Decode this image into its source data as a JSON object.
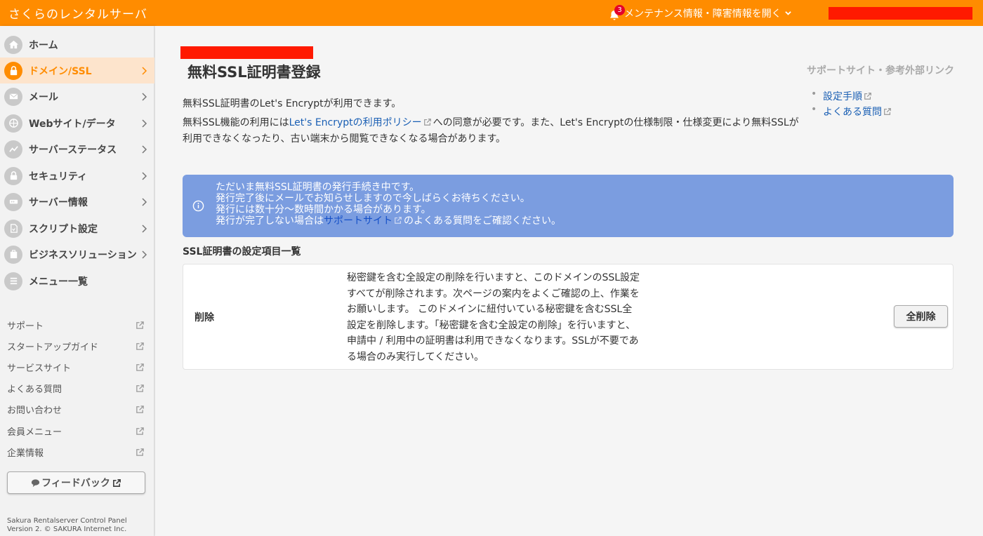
{
  "header": {
    "brand": "さくらのレンタルサーバ",
    "notification_count": "3",
    "maintenance_label": "メンテナンス情報・障害情報を開く"
  },
  "sidebar": {
    "items": [
      {
        "label": "ホーム",
        "icon": "home-icon"
      },
      {
        "label": "ドメイン/SSL",
        "icon": "lock-icon",
        "active": true
      },
      {
        "label": "メール",
        "icon": "mail-icon"
      },
      {
        "label": "Webサイト/データ",
        "icon": "globe-icon"
      },
      {
        "label": "サーバーステータス",
        "icon": "chart-icon"
      },
      {
        "label": "セキュリティ",
        "icon": "padlock-icon"
      },
      {
        "label": "サーバー情報",
        "icon": "server-icon"
      },
      {
        "label": "スクリプト設定",
        "icon": "script-icon"
      },
      {
        "label": "ビジネスソリューション",
        "icon": "business-icon"
      },
      {
        "label": "メニュー一覧",
        "icon": "list-icon"
      }
    ],
    "links": [
      {
        "label": "サポート"
      },
      {
        "label": "スタートアップガイド"
      },
      {
        "label": "サービスサイト"
      },
      {
        "label": "よくある質問"
      },
      {
        "label": "お問い合わせ"
      },
      {
        "label": "会員メニュー"
      },
      {
        "label": "企業情報"
      }
    ],
    "feedback_label": "フィードバック",
    "footer_line1": "Sakura Rentalserver Control Panel",
    "footer_line2": "Version 2. © SAKURA Internet Inc."
  },
  "main": {
    "page_title": "無料SSL証明書登録",
    "desc_line1": "無料SSL証明書のLet's Encryptが利用できます。",
    "desc_line2_prefix": "無料SSL機能の利用には",
    "desc_line2_link": "Let's Encryptの利用ポリシー",
    "desc_line2_suffix": "への同意が必要です。また、Let's Encryptの仕様制限・仕様変更により無料SSLが利用できなくなったり、古い端末から閲覧できなくなる場合があります。",
    "support": {
      "title": "サポートサイト・参考外部リンク",
      "links": [
        "設定手順",
        "よくある質問"
      ]
    },
    "info": {
      "line1": "ただいま無料SSL証明書の発行手続き中です。",
      "line2": "発行完了後にメールでお知らせしますので今しばらくお待ちください。",
      "line3": "発行には数十分〜数時間かかる場合があります。",
      "line4_prefix": "発行が完了しない場合は",
      "line4_link": "サポートサイト",
      "line4_suffix": "のよくある質問をご確認ください。"
    },
    "section_title": "SSL証明書の設定項目一覧",
    "row": {
      "label": "削除",
      "description": "秘密鍵を含む全設定の削除を行いますと、このドメインのSSL設定すべてが削除されます。次ページの案内をよくご確認の上、作業をお願いします。 このドメインに紐付いている秘密鍵を含むSSL全設定を削除します。「秘密鍵を含む全設定の削除」を行いますと、申請中 / 利用中の証明書は利用できなくなります。SSLが不要である場合のみ実行してください。",
      "button": "全削除"
    }
  },
  "colors": {
    "brand_orange": "#ff8c00",
    "active_bg": "#fde4cc",
    "info_bg": "#7b9de0",
    "link": "#1a5fb4",
    "redaction": "#ff1a00"
  }
}
